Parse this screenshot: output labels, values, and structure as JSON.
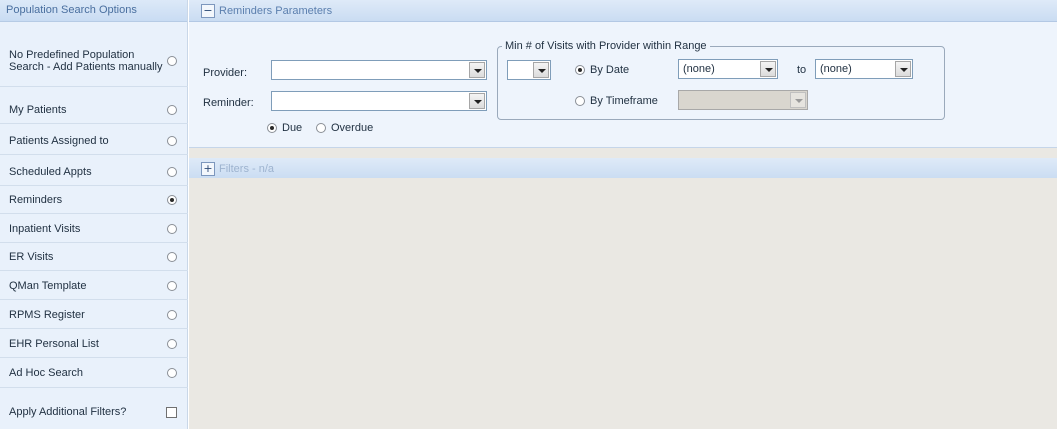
{
  "left_panel": {
    "header": "Population Search Options",
    "options": [
      {
        "label": "No Predefined Population Search - Add Patients manually",
        "checked": false
      },
      {
        "label": "My Patients",
        "checked": false
      },
      {
        "label": "Patients Assigned to",
        "checked": false
      },
      {
        "label": "Scheduled Appts",
        "checked": false
      },
      {
        "label": "Reminders",
        "checked": true
      },
      {
        "label": "Inpatient Visits",
        "checked": false
      },
      {
        "label": "ER Visits",
        "checked": false
      },
      {
        "label": "QMan Template",
        "checked": false
      },
      {
        "label": "RPMS Register",
        "checked": false
      },
      {
        "label": "EHR Personal List",
        "checked": false
      },
      {
        "label": "Ad Hoc Search",
        "checked": false
      }
    ],
    "apply_filters": {
      "label": "Apply Additional Filters?",
      "checked": false
    }
  },
  "reminders_section": {
    "toggle": "−",
    "title": "Reminders Parameters",
    "provider_label": "Provider:",
    "provider_value": "",
    "reminder_label": "Reminder:",
    "reminder_value": "",
    "due_label": "Due",
    "due_checked": true,
    "overdue_label": "Overdue",
    "overdue_checked": false,
    "visits_group": {
      "legend": "Min # of Visits with Provider within Range",
      "count_value": "",
      "by_date_label": "By Date",
      "by_date_checked": true,
      "from_value": "(none)",
      "to_label": "to",
      "to_value": "(none)",
      "by_timeframe_label": "By Timeframe",
      "by_timeframe_checked": false,
      "timeframe_value": ""
    }
  },
  "filters_section": {
    "toggle": "+",
    "title": "Filters - n/a"
  }
}
